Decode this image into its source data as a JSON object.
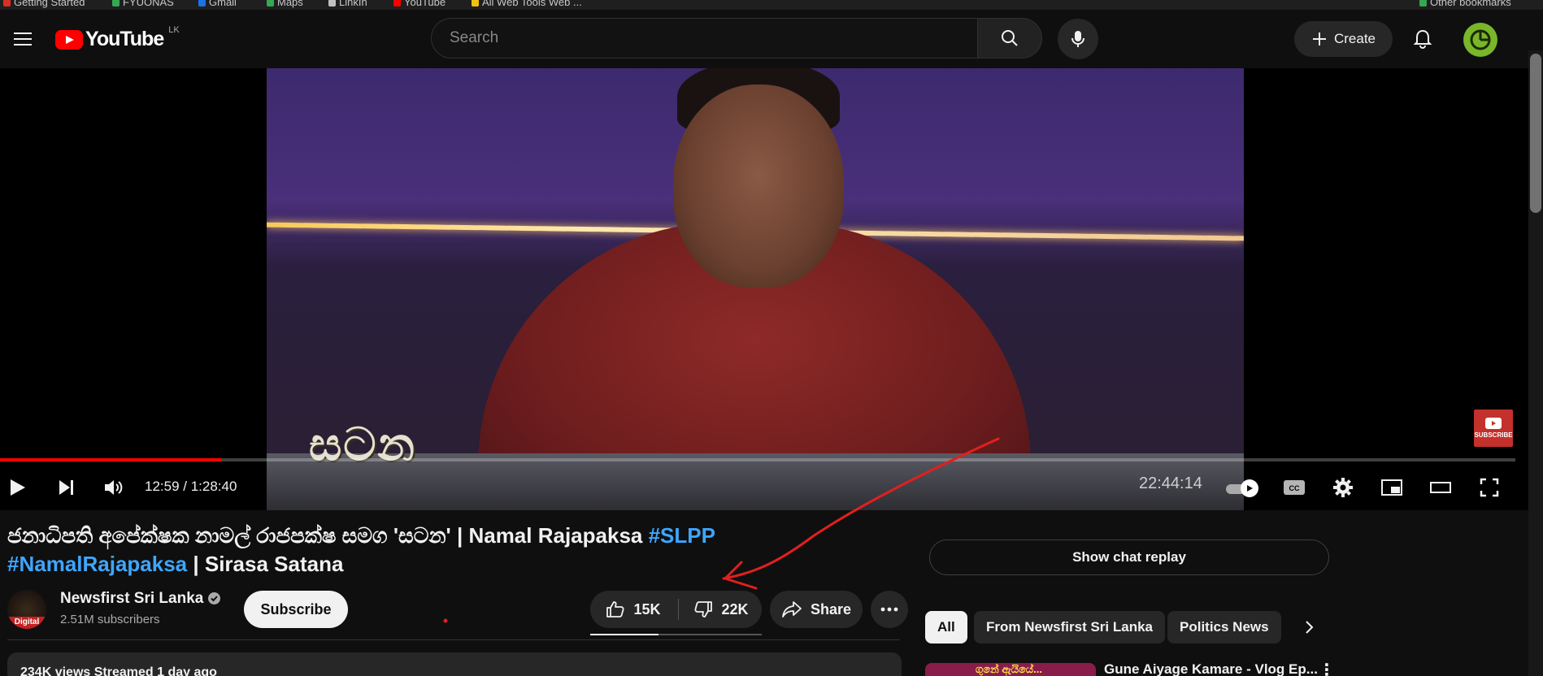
{
  "bookmarks": [
    {
      "label": "Getting Started",
      "color": "#d93025"
    },
    {
      "label": "FYUONAS",
      "color": "#34a853"
    },
    {
      "label": "Gmail",
      "color": "#1a73e8"
    },
    {
      "label": "Maps",
      "color": "#34a853"
    },
    {
      "label": "LinkIn",
      "color": "#c0c0c0"
    },
    {
      "label": "YouTube",
      "color": "#ff0000"
    },
    {
      "label": "All Web Tools Web ...",
      "color": "#f1c40f"
    },
    {
      "label": "Other bookmarks",
      "color": "#34a853"
    }
  ],
  "masthead": {
    "logo_text": "YouTube",
    "country_code": "LK",
    "search_placeholder": "Search",
    "create_label": "Create"
  },
  "player": {
    "current_time": "12:59",
    "duration": "1:28:40",
    "progress_percent": 14.6,
    "overlay_logo": "සටන",
    "overlay_clock": "22:44:14",
    "subscribe_watermark": "SUBSCRIBE"
  },
  "video": {
    "title_main": "ජනාධිපති අපේක්ෂක නාමල් රාජපක්ෂ සමග 'සටන' | Namal Rajapaksa ",
    "tag1": "#SLPP",
    "tag2": "#NamalRajapaksa",
    "title_tail": " | Sirasa Satana",
    "views_line": "234K views  Streamed 1 day ago"
  },
  "channel": {
    "name": "Newsfirst Sri Lanka",
    "subscribers": "2.51M subscribers",
    "avatar_label": "Digital",
    "subscribe_label": "Subscribe"
  },
  "actions": {
    "likes": "15K",
    "dislikes": "22K",
    "like_ratio_percent": 40,
    "share_label": "Share"
  },
  "sidebar": {
    "chat_replay_label": "Show chat replay",
    "chips": [
      "All",
      "From Newsfirst Sri Lanka",
      "Politics News"
    ],
    "rec_title": "Gune Aiyage Kamare - Vlog Ep...",
    "rec_thumb_text": "ගුනේ ඇයියේ..."
  },
  "colors": {
    "accent_red": "#ff0000",
    "link_blue": "#3ea6ff",
    "annotation_red": "#e0201e",
    "bg": "#0f0f0f"
  }
}
